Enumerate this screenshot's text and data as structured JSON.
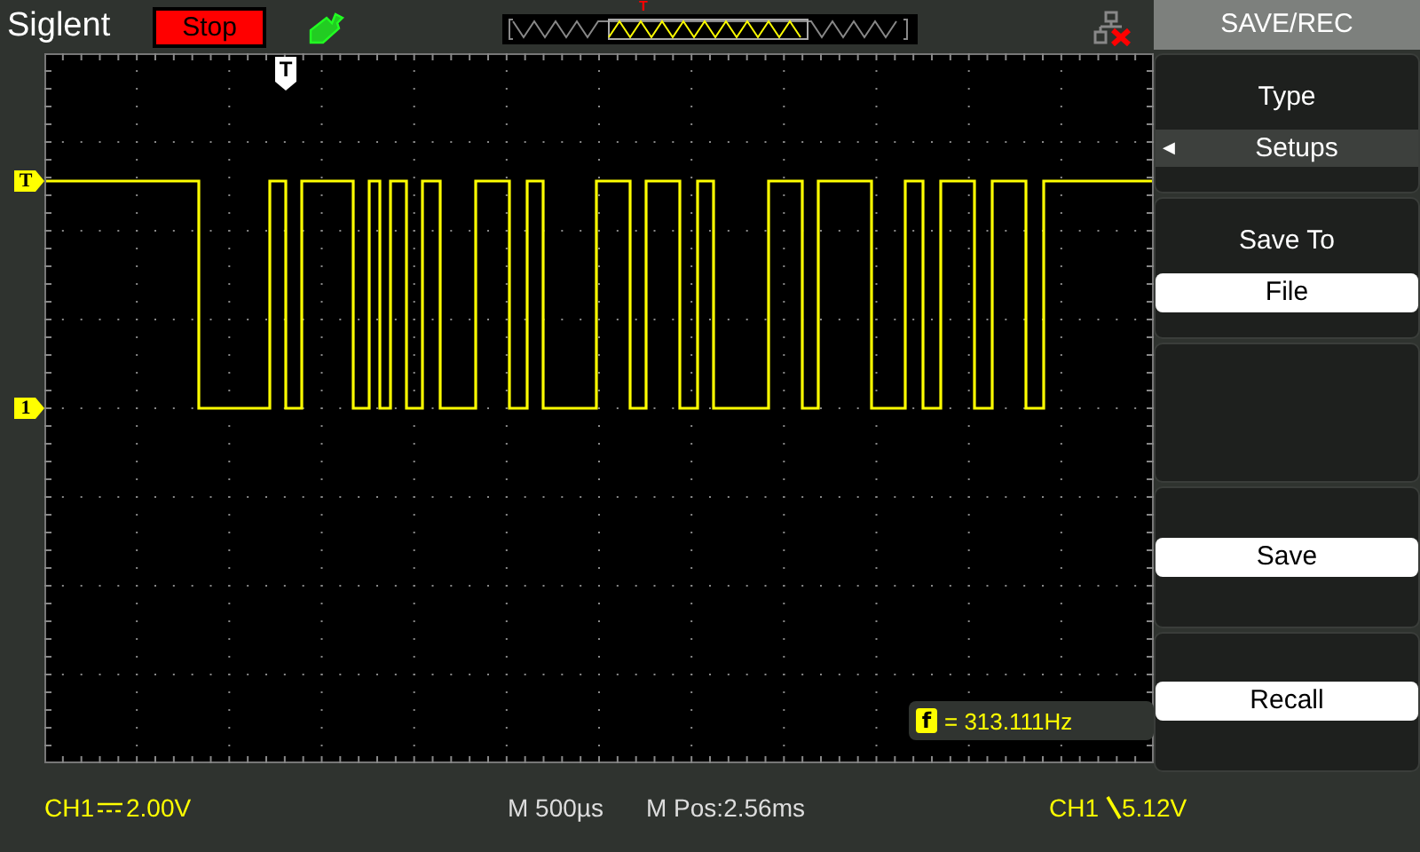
{
  "header": {
    "brand": "Siglent",
    "run_state": "Stop",
    "overview_trigger": "T"
  },
  "screen": {
    "trigger_marker": "T",
    "level_marker": "T",
    "channel_marker": "1",
    "measurement": {
      "symbol": "f",
      "reading": "= 313.111Hz"
    }
  },
  "menu": {
    "title": "SAVE/REC",
    "items": [
      {
        "kind": "cycle",
        "label": "Type",
        "arrow": "◀",
        "value": "Setups"
      },
      {
        "kind": "select",
        "label": "Save To",
        "value": "File"
      },
      {
        "kind": "blank"
      },
      {
        "kind": "button",
        "label": "Save"
      },
      {
        "kind": "button",
        "label": "Recall"
      }
    ]
  },
  "status_bar": {
    "channel": {
      "name": "CH1",
      "scale": "2.00V"
    },
    "timebase": "M 500µs",
    "position": "M Pos:2.56ms",
    "trigger": {
      "source": "CH1",
      "level": "5.12V"
    }
  }
}
